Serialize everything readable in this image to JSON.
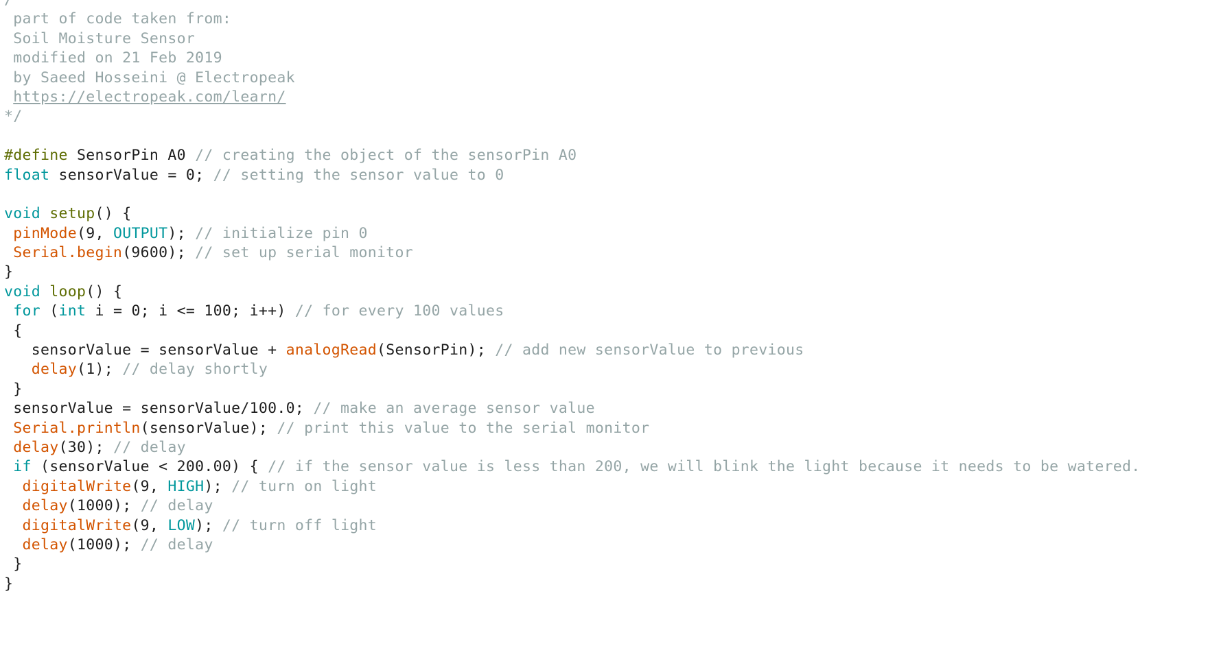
{
  "colors": {
    "background": "#ffffff",
    "plain_text": "#1e1e1e",
    "comment": "#95a5a6",
    "keyword_type": "#00979c",
    "constant": "#00979c",
    "preprocessor": "#5e6d03",
    "function_name": "#5e6d03",
    "builtin_function": "#d35400"
  },
  "code_lines": [
    [
      {
        "t": "/*",
        "c": "cm"
      }
    ],
    [
      {
        "t": " part of code taken from:",
        "c": "cm"
      }
    ],
    [
      {
        "t": " Soil Moisture Sensor",
        "c": "cm"
      }
    ],
    [
      {
        "t": " modified on 21 Feb 2019",
        "c": "cm"
      }
    ],
    [
      {
        "t": " by Saeed Hosseini @ Electropeak",
        "c": "cm"
      }
    ],
    [
      {
        "t": " ",
        "c": "cm"
      },
      {
        "t": "https://electropeak.com/learn/",
        "c": "cm-link"
      }
    ],
    [
      {
        "t": "*/",
        "c": "cm"
      }
    ],
    [
      {
        "t": "",
        "c": "pl"
      }
    ],
    [
      {
        "t": "#define",
        "c": "pp"
      },
      {
        "t": " SensorPin A0 ",
        "c": "pl"
      },
      {
        "t": "// creating the object of the sensorPin A0",
        "c": "cm"
      }
    ],
    [
      {
        "t": "float",
        "c": "kw"
      },
      {
        "t": " sensorValue = 0; ",
        "c": "pl"
      },
      {
        "t": "// setting the sensor value to 0",
        "c": "cm"
      }
    ],
    [
      {
        "t": "",
        "c": "pl"
      }
    ],
    [
      {
        "t": "void",
        "c": "kw"
      },
      {
        "t": " ",
        "c": "pl"
      },
      {
        "t": "setup",
        "c": "fn"
      },
      {
        "t": "() {",
        "c": "pl"
      }
    ],
    [
      {
        "t": " ",
        "c": "pl"
      },
      {
        "t": "pinMode",
        "c": "bi"
      },
      {
        "t": "(9, ",
        "c": "pl"
      },
      {
        "t": "OUTPUT",
        "c": "ct"
      },
      {
        "t": "); ",
        "c": "pl"
      },
      {
        "t": "// initialize pin 0",
        "c": "cm"
      }
    ],
    [
      {
        "t": " ",
        "c": "pl"
      },
      {
        "t": "Serial.begin",
        "c": "bi"
      },
      {
        "t": "(9600); ",
        "c": "pl"
      },
      {
        "t": "// set up serial monitor",
        "c": "cm"
      }
    ],
    [
      {
        "t": "}",
        "c": "pl"
      }
    ],
    [
      {
        "t": "void",
        "c": "kw"
      },
      {
        "t": " ",
        "c": "pl"
      },
      {
        "t": "loop",
        "c": "fn"
      },
      {
        "t": "() {",
        "c": "pl"
      }
    ],
    [
      {
        "t": " ",
        "c": "pl"
      },
      {
        "t": "for",
        "c": "cf"
      },
      {
        "t": " (",
        "c": "pl"
      },
      {
        "t": "int",
        "c": "kw"
      },
      {
        "t": " i = 0; i <= 100; i++) ",
        "c": "pl"
      },
      {
        "t": "// for every 100 values",
        "c": "cm"
      }
    ],
    [
      {
        "t": " {",
        "c": "pl"
      }
    ],
    [
      {
        "t": "   sensorValue = sensorValue + ",
        "c": "pl"
      },
      {
        "t": "analogRead",
        "c": "bi"
      },
      {
        "t": "(SensorPin); ",
        "c": "pl"
      },
      {
        "t": "// add new sensorValue to previous",
        "c": "cm"
      }
    ],
    [
      {
        "t": "   ",
        "c": "pl"
      },
      {
        "t": "delay",
        "c": "bi"
      },
      {
        "t": "(1); ",
        "c": "pl"
      },
      {
        "t": "// delay shortly",
        "c": "cm"
      }
    ],
    [
      {
        "t": " }",
        "c": "pl"
      }
    ],
    [
      {
        "t": " sensorValue = sensorValue/100.0; ",
        "c": "pl"
      },
      {
        "t": "// make an average sensor value",
        "c": "cm"
      }
    ],
    [
      {
        "t": " ",
        "c": "pl"
      },
      {
        "t": "Serial.println",
        "c": "bi"
      },
      {
        "t": "(sensorValue); ",
        "c": "pl"
      },
      {
        "t": "// print this value to the serial monitor",
        "c": "cm"
      }
    ],
    [
      {
        "t": " ",
        "c": "pl"
      },
      {
        "t": "delay",
        "c": "bi"
      },
      {
        "t": "(30); ",
        "c": "pl"
      },
      {
        "t": "// delay",
        "c": "cm"
      }
    ],
    [
      {
        "t": " ",
        "c": "pl"
      },
      {
        "t": "if",
        "c": "cf"
      },
      {
        "t": " (sensorValue < 200.00) { ",
        "c": "pl"
      },
      {
        "t": "// if the sensor value is less than 200, we will blink the light because it needs to be watered.",
        "c": "cm"
      }
    ],
    [
      {
        "t": "  ",
        "c": "pl"
      },
      {
        "t": "digitalWrite",
        "c": "bi"
      },
      {
        "t": "(9, ",
        "c": "pl"
      },
      {
        "t": "HIGH",
        "c": "ct"
      },
      {
        "t": "); ",
        "c": "pl"
      },
      {
        "t": "// turn on light",
        "c": "cm"
      }
    ],
    [
      {
        "t": "  ",
        "c": "pl"
      },
      {
        "t": "delay",
        "c": "bi"
      },
      {
        "t": "(1000); ",
        "c": "pl"
      },
      {
        "t": "// delay",
        "c": "cm"
      }
    ],
    [
      {
        "t": "  ",
        "c": "pl"
      },
      {
        "t": "digitalWrite",
        "c": "bi"
      },
      {
        "t": "(9, ",
        "c": "pl"
      },
      {
        "t": "LOW",
        "c": "ct"
      },
      {
        "t": "); ",
        "c": "pl"
      },
      {
        "t": "// turn off light",
        "c": "cm"
      }
    ],
    [
      {
        "t": "  ",
        "c": "pl"
      },
      {
        "t": "delay",
        "c": "bi"
      },
      {
        "t": "(1000); ",
        "c": "pl"
      },
      {
        "t": "// delay",
        "c": "cm"
      }
    ],
    [
      {
        "t": " }",
        "c": "pl"
      }
    ],
    [
      {
        "t": "}",
        "c": "pl"
      }
    ]
  ]
}
